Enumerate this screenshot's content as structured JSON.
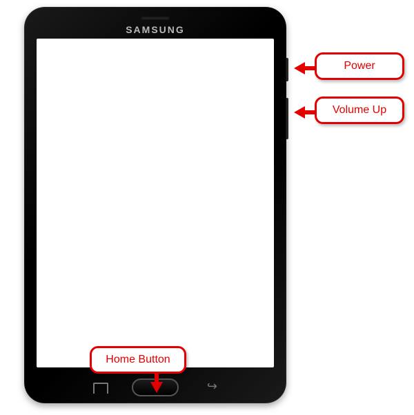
{
  "device": {
    "brand": "SAMSUNG"
  },
  "callouts": {
    "power": {
      "label": "Power"
    },
    "volume": {
      "label": "Volume Up"
    },
    "home": {
      "label": "Home Button"
    }
  }
}
